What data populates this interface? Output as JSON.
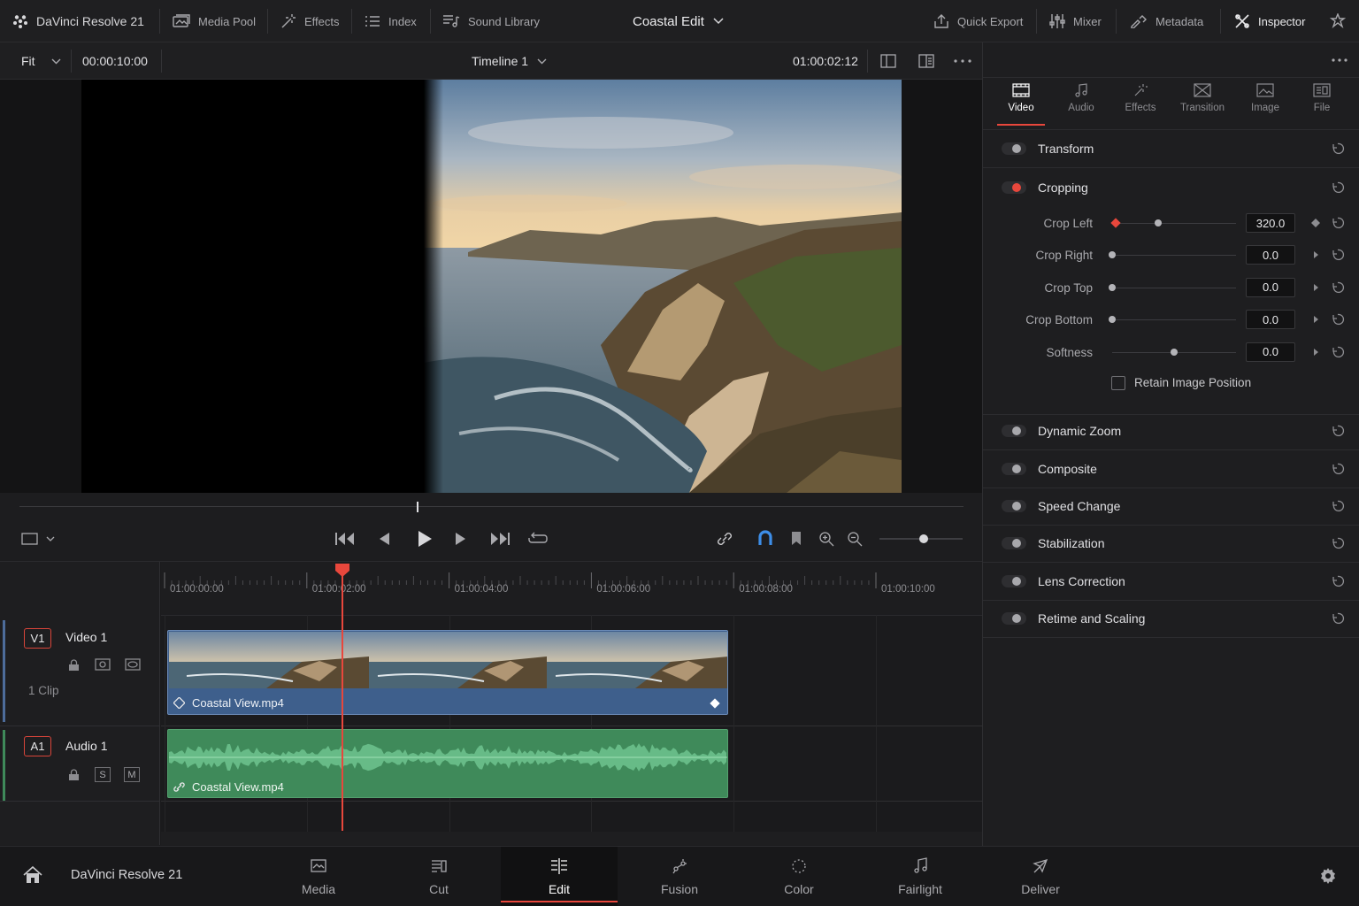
{
  "app": {
    "name": "DaVinci Resolve 21"
  },
  "topbar": {
    "media_pool": "Media Pool",
    "effects": "Effects",
    "index": "Index",
    "sound_library": "Sound Library",
    "project_title": "Coastal Edit",
    "quick_export": "Quick Export",
    "mixer": "Mixer",
    "metadata": "Metadata",
    "inspector": "Inspector"
  },
  "viewer": {
    "zoom": "Fit",
    "source_timecode": "00:00:10:00",
    "timeline_name": "Timeline 1",
    "record_timecode": "01:00:02:12"
  },
  "timeline": {
    "ruler": [
      "01:00:00:00",
      "01:00:02:00",
      "01:00:04:00",
      "01:00:06:00",
      "01:00:08:00",
      "01:00:10:00"
    ],
    "tracks": {
      "video": {
        "badge": "V1",
        "name": "Video 1",
        "count": "1 Clip",
        "clip": "Coastal View.mp4"
      },
      "audio": {
        "badge": "A1",
        "name": "Audio 1",
        "solo": "S",
        "mute": "M",
        "clip": "Coastal View.mp4"
      }
    },
    "playhead_seconds": 2.5
  },
  "inspector": {
    "tabs": [
      "Video",
      "Audio",
      "Effects",
      "Transition",
      "Image",
      "File"
    ],
    "active_tab": "Video",
    "transform": "Transform",
    "cropping": {
      "title": "Cropping",
      "params": [
        {
          "label": "Crop Left",
          "value": "320.0",
          "level": 0.37
        },
        {
          "label": "Crop Right",
          "value": "0.0",
          "level": 0.0
        },
        {
          "label": "Crop Top",
          "value": "0.0",
          "level": 0.0
        },
        {
          "label": "Crop Bottom",
          "value": "0.0",
          "level": 0.0
        },
        {
          "label": "Softness",
          "value": "0.0",
          "level": 0.5
        }
      ],
      "retain": "Retain Image Position"
    },
    "sections": [
      "Dynamic Zoom",
      "Composite",
      "Speed Change",
      "Stabilization",
      "Lens Correction",
      "Retime and Scaling"
    ]
  },
  "pagebar": {
    "app_name": "DaVinci Resolve 21",
    "pages": [
      "Media",
      "Cut",
      "Edit",
      "Fusion",
      "Color",
      "Fairlight",
      "Deliver"
    ],
    "active": "Edit"
  },
  "colors": {
    "accent_red": "#e8473c",
    "video_clip": "#3e5f8c",
    "audio_clip": "#3f8a5a"
  }
}
